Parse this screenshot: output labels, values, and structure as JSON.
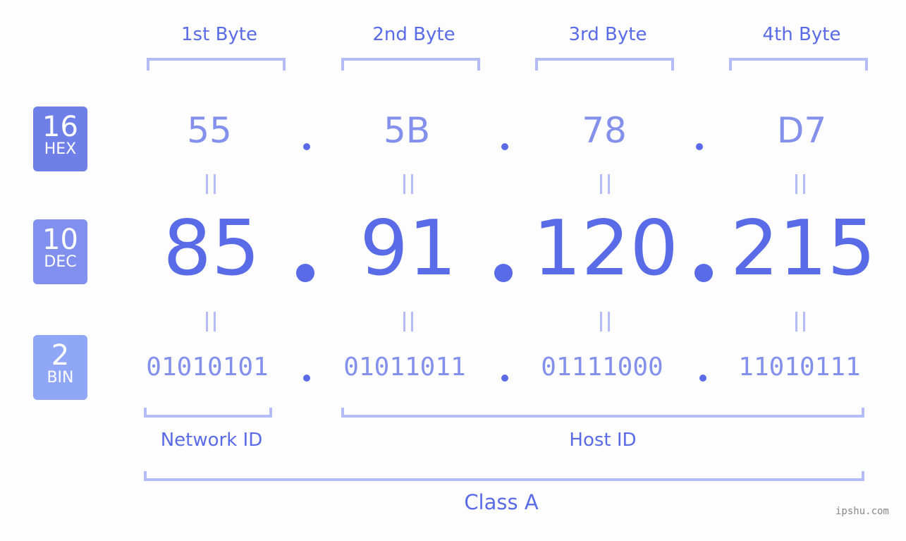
{
  "bytes": [
    {
      "label": "1st Byte",
      "hex": "55",
      "dec": "85",
      "bin": "01010101"
    },
    {
      "label": "2nd Byte",
      "hex": "5B",
      "dec": "91",
      "bin": "01011011"
    },
    {
      "label": "3rd Byte",
      "hex": "78",
      "dec": "120",
      "bin": "01111000"
    },
    {
      "label": "4th Byte",
      "hex": "D7",
      "dec": "215",
      "bin": "11010111"
    }
  ],
  "badges": {
    "hex": {
      "num": "16",
      "label": "HEX",
      "color": "#6f7fe8"
    },
    "dec": {
      "num": "10",
      "label": "DEC",
      "color": "#8190ef"
    },
    "bin": {
      "num": "2",
      "label": "BIN",
      "color": "#90a7f7"
    }
  },
  "network_id": "Network ID",
  "host_id": "Host ID",
  "class_label": "Class A",
  "watermark": "ipshu.com"
}
